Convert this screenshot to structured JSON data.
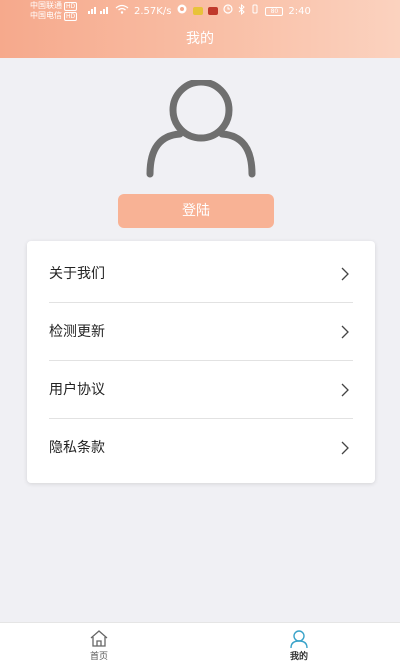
{
  "status_bar": {
    "carrier1": "中国联通",
    "carrier2": "中国电信",
    "hd": "HD",
    "speed": "2.57K/s",
    "battery": "80",
    "time": "2:40",
    "icons": [
      "signal-icon",
      "wifi-icon",
      "app-notification-icon",
      "alarm-icon",
      "bluetooth-icon",
      "vibrate-icon",
      "battery-icon"
    ]
  },
  "header": {
    "title": "我的"
  },
  "login_button": {
    "label": "登陆"
  },
  "menu": {
    "items": [
      {
        "label": "关于我们"
      },
      {
        "label": "检测更新"
      },
      {
        "label": "用户协议"
      },
      {
        "label": "隐私条款"
      }
    ]
  },
  "bottom_nav": {
    "items": [
      {
        "label": "首页",
        "icon": "home-icon"
      },
      {
        "label": "我的",
        "icon": "user-icon"
      }
    ]
  },
  "colors": {
    "header_gradient_start": "#f6a98c",
    "header_gradient_end": "#fbd2bf",
    "login_button": "#f8b295",
    "background": "#f0f0f4"
  }
}
